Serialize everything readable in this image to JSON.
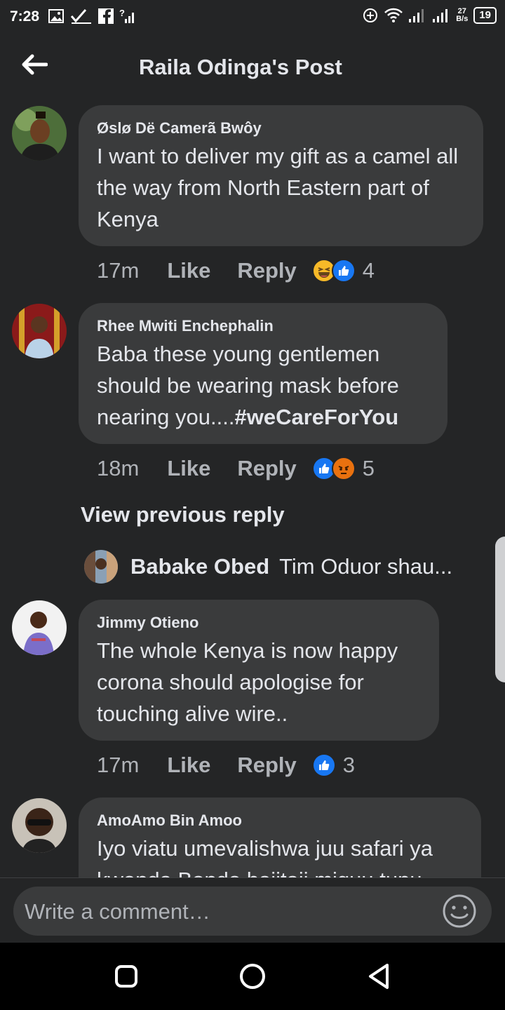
{
  "status_bar": {
    "time": "7:28",
    "rate_value": "27",
    "rate_unit": "B/s",
    "battery": "19"
  },
  "header": {
    "title": "Raila Odinga's Post"
  },
  "comments": [
    {
      "author": "Øslø Dë Camerã Bwôy",
      "text": "I want to deliver my gift as a camel all the way from North Eastern part of Kenya",
      "time": "17m",
      "like_label": "Like",
      "reply_label": "Reply",
      "reactions": [
        "haha-icon",
        "like-icon"
      ],
      "reaction_count": "4"
    },
    {
      "author": "Rhee Mwiti Enchephalin",
      "text_plain": "Baba these young gentlemen should be wearing mask before nearing you....",
      "hashtag": "#weCareForYou",
      "time": "18m",
      "like_label": "Like",
      "reply_label": "Reply",
      "reactions": [
        "like-icon",
        "angry-icon"
      ],
      "reaction_count": "5"
    },
    {
      "author": "Jimmy Otieno",
      "text": "The whole Kenya is now happy corona should apologise for touching alive wire..",
      "time": "17m",
      "like_label": "Like",
      "reply_label": "Reply",
      "reactions": [
        "like-icon"
      ],
      "reaction_count": "3"
    },
    {
      "author": "AmoAmo Bin Amoo",
      "text": "Iyo viatu umevalishwa juu safari ya kwenda Bondo haiitaji miguu tupu"
    }
  ],
  "replies_section": {
    "view_previous_label": "View previous reply",
    "preview_author": "Babake Obed",
    "preview_text": "Tim Oduor shau..."
  },
  "composer": {
    "placeholder": "Write a comment…"
  },
  "colors": {
    "background": "#242526",
    "bubble": "#3a3b3c",
    "text_primary": "#e4e6eb",
    "text_secondary": "#b0b3b8",
    "like_blue": "#1877f2",
    "angry_orange": "#e9710f",
    "haha_yellow": "#f7b928"
  }
}
